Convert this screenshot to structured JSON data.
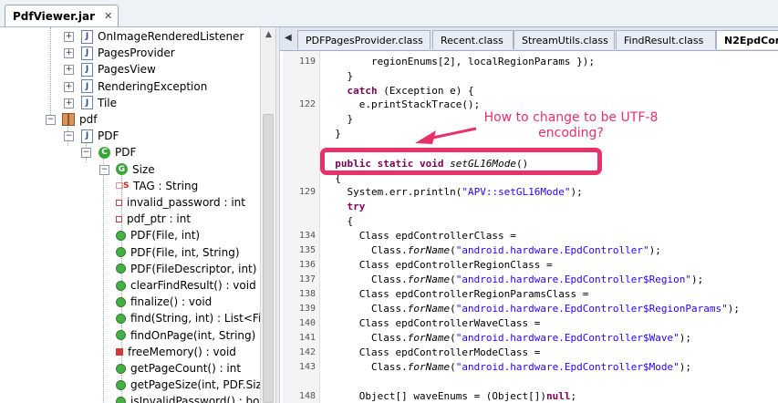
{
  "window": {
    "tab_title": "PdfViewer.jar"
  },
  "tree": {
    "items": [
      {
        "label": "OnImageRenderedListener",
        "icon": "java-file-icon"
      },
      {
        "label": "PagesProvider",
        "icon": "java-file-icon"
      },
      {
        "label": "PagesView",
        "icon": "java-file-icon"
      },
      {
        "label": "RenderingException",
        "icon": "java-file-icon"
      },
      {
        "label": "Tile",
        "icon": "java-file-icon"
      },
      {
        "label": "pdf",
        "icon": "package-icon"
      },
      {
        "label": "PDF",
        "icon": "java-file-icon"
      },
      {
        "label": "PDF",
        "icon": "class-icon"
      },
      {
        "label": "Size",
        "icon": "inner-class-icon"
      },
      {
        "label": "TAG : String",
        "icon": "static-field-icon"
      },
      {
        "label": "invalid_password : int",
        "icon": "private-field-icon"
      },
      {
        "label": "pdf_ptr : int",
        "icon": "private-field-icon"
      },
      {
        "label": "PDF(File, int)",
        "icon": "public-method-icon"
      },
      {
        "label": "PDF(File, int, String)",
        "icon": "public-method-icon"
      },
      {
        "label": "PDF(FileDescriptor, int)",
        "icon": "public-method-icon"
      },
      {
        "label": "clearFindResult() : void",
        "icon": "public-method-icon"
      },
      {
        "label": "finalize() : void",
        "icon": "public-method-icon"
      },
      {
        "label": "find(String, int) : List<FindR",
        "icon": "public-method-icon"
      },
      {
        "label": "findOnPage(int, String) : Li",
        "icon": "public-method-icon"
      },
      {
        "label": "freeMemory() : void",
        "icon": "private-method-icon"
      },
      {
        "label": "getPageCount() : int",
        "icon": "public-method-icon"
      },
      {
        "label": "getPageSize(int, PDF.Size) :",
        "icon": "public-method-icon"
      },
      {
        "label": "isInvalidPassword() : boole",
        "icon": "public-method-icon"
      }
    ]
  },
  "editor_tabs": [
    {
      "label": "PDFPagesProvider.class",
      "active": false
    },
    {
      "label": "Recent.class",
      "active": false
    },
    {
      "label": "StreamUtils.class",
      "active": false
    },
    {
      "label": "FindResult.class",
      "active": false
    },
    {
      "label": "N2EpdContr",
      "active": true
    }
  ],
  "code_lines": [
    {
      "ln": "119",
      "tokens": [
        {
          "t": "        regionEnums[2], localRegionParams });"
        }
      ]
    },
    {
      "ln": "",
      "tokens": [
        {
          "t": "    }"
        }
      ]
    },
    {
      "ln": "",
      "tokens": [
        {
          "t": "    "
        },
        {
          "t": "catch",
          "c": "kw"
        },
        {
          "t": " (Exception e) {"
        }
      ]
    },
    {
      "ln": "122",
      "tokens": [
        {
          "t": "      e.printStackTrace();"
        }
      ]
    },
    {
      "ln": "",
      "tokens": [
        {
          "t": "    }"
        }
      ]
    },
    {
      "ln": "",
      "tokens": [
        {
          "t": "  }"
        }
      ]
    },
    {
      "ln": "",
      "tokens": [
        {
          "t": ""
        }
      ]
    },
    {
      "ln": "",
      "tokens": [
        {
          "t": "  "
        },
        {
          "t": "public static void",
          "c": "kw"
        },
        {
          "t": " "
        },
        {
          "t": "setGL16Mode",
          "c": "it"
        },
        {
          "t": "()"
        }
      ]
    },
    {
      "ln": "",
      "tokens": [
        {
          "t": "  {"
        }
      ]
    },
    {
      "ln": "129",
      "tokens": [
        {
          "t": "    System.err.println("
        },
        {
          "t": "\"APV::setGL16Mode\"",
          "c": "str"
        },
        {
          "t": ");"
        }
      ]
    },
    {
      "ln": "",
      "tokens": [
        {
          "t": "    "
        },
        {
          "t": "try",
          "c": "kw"
        }
      ]
    },
    {
      "ln": "",
      "tokens": [
        {
          "t": "    {"
        }
      ]
    },
    {
      "ln": "134",
      "tokens": [
        {
          "t": "      Class epdControllerClass ="
        }
      ]
    },
    {
      "ln": "135",
      "tokens": [
        {
          "t": "        Class."
        },
        {
          "t": "forName",
          "c": "it"
        },
        {
          "t": "("
        },
        {
          "t": "\"android.hardware.EpdController\"",
          "c": "str"
        },
        {
          "t": ");"
        }
      ]
    },
    {
      "ln": "136",
      "tokens": [
        {
          "t": "      Class epdControllerRegionClass ="
        }
      ]
    },
    {
      "ln": "137",
      "tokens": [
        {
          "t": "        Class."
        },
        {
          "t": "forName",
          "c": "it"
        },
        {
          "t": "("
        },
        {
          "t": "\"android.hardware.EpdController$Region\"",
          "c": "str"
        },
        {
          "t": ");"
        }
      ]
    },
    {
      "ln": "138",
      "tokens": [
        {
          "t": "      Class epdControllerRegionParamsClass ="
        }
      ]
    },
    {
      "ln": "139",
      "tokens": [
        {
          "t": "        Class."
        },
        {
          "t": "forName",
          "c": "it"
        },
        {
          "t": "("
        },
        {
          "t": "\"android.hardware.EpdController$RegionParams\"",
          "c": "str"
        },
        {
          "t": ");"
        }
      ]
    },
    {
      "ln": "140",
      "tokens": [
        {
          "t": "      Class epdControllerWaveClass ="
        }
      ]
    },
    {
      "ln": "141",
      "tokens": [
        {
          "t": "        Class."
        },
        {
          "t": "forName",
          "c": "it"
        },
        {
          "t": "("
        },
        {
          "t": "\"android.hardware.EpdController$Wave\"",
          "c": "str"
        },
        {
          "t": ");"
        }
      ]
    },
    {
      "ln": "142",
      "tokens": [
        {
          "t": "      Class epdControllerModeClass ="
        }
      ]
    },
    {
      "ln": "143",
      "tokens": [
        {
          "t": "        Class."
        },
        {
          "t": "forName",
          "c": "it"
        },
        {
          "t": "("
        },
        {
          "t": "\"android.hardware.EpdController$Mode\"",
          "c": "str"
        },
        {
          "t": ");"
        }
      ]
    },
    {
      "ln": "",
      "tokens": [
        {
          "t": ""
        }
      ]
    },
    {
      "ln": "148",
      "tokens": [
        {
          "t": "      Object[] waveEnums = (Object[])"
        },
        {
          "t": "null",
          "c": "kw"
        },
        {
          "t": ";"
        }
      ]
    }
  ],
  "annotation": {
    "text_line1": "How to change to be UTF-8",
    "text_line2": "encoding?",
    "color": "#e8306a"
  }
}
